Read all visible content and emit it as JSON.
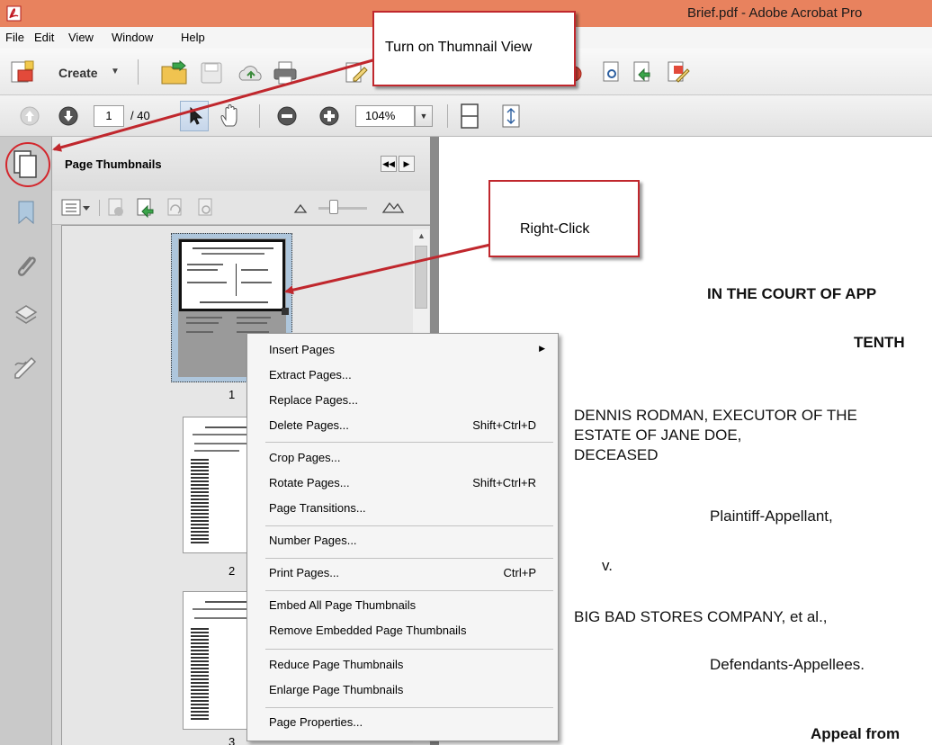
{
  "window": {
    "title": "Brief.pdf - Adobe Acrobat Pro"
  },
  "menubar": {
    "items": [
      {
        "label": "File"
      },
      {
        "label": "Edit"
      },
      {
        "label": "View"
      },
      {
        "label": "Window"
      },
      {
        "label": "Help"
      }
    ]
  },
  "toolbar": {
    "create_label": "Create"
  },
  "navigation": {
    "current_page": "1",
    "total_pages": "/ 40",
    "zoom": "104%"
  },
  "panel": {
    "title": "Page Thumbnails"
  },
  "thumbnails": [
    {
      "page": "1"
    },
    {
      "page": "2"
    },
    {
      "page": "3"
    }
  ],
  "context_menu": {
    "items": [
      {
        "label": "Insert Pages",
        "shortcut": ""
      },
      {
        "label": "Extract Pages...",
        "shortcut": ""
      },
      {
        "label": "Replace Pages...",
        "shortcut": ""
      },
      {
        "label": "Delete Pages...",
        "shortcut": "Shift+Ctrl+D"
      },
      {
        "label": "Crop Pages...",
        "shortcut": ""
      },
      {
        "label": "Rotate Pages...",
        "shortcut": "Shift+Ctrl+R"
      },
      {
        "label": "Page Transitions...",
        "shortcut": ""
      },
      {
        "label": "Number Pages...",
        "shortcut": ""
      },
      {
        "label": "Print Pages...",
        "shortcut": "Ctrl+P"
      },
      {
        "label": "Embed All Page Thumbnails",
        "shortcut": ""
      },
      {
        "label": "Remove Embedded Page Thumbnails",
        "shortcut": ""
      },
      {
        "label": "Reduce Page Thumbnails",
        "shortcut": ""
      },
      {
        "label": "Enlarge Page Thumbnails",
        "shortcut": ""
      },
      {
        "label": "Page Properties...",
        "shortcut": ""
      }
    ]
  },
  "document": {
    "lines": [
      "IN THE COURT OF APP",
      "TENTH",
      "DENNIS RODMAN, EXECUTOR OF THE",
      "ESTATE OF JANE DOE,",
      "DECEASED",
      "Plaintiff-Appellant,",
      "v.",
      "BIG BAD STORES COMPANY, et al.,",
      "Defendants-Appellees.",
      "Appeal from"
    ]
  },
  "callouts": {
    "thumbnail_view": "Turn on Thumnail View",
    "right_click": "Right-Click"
  },
  "colors": {
    "titlebar": "#e8825e",
    "callout_border": "#c0272d"
  }
}
